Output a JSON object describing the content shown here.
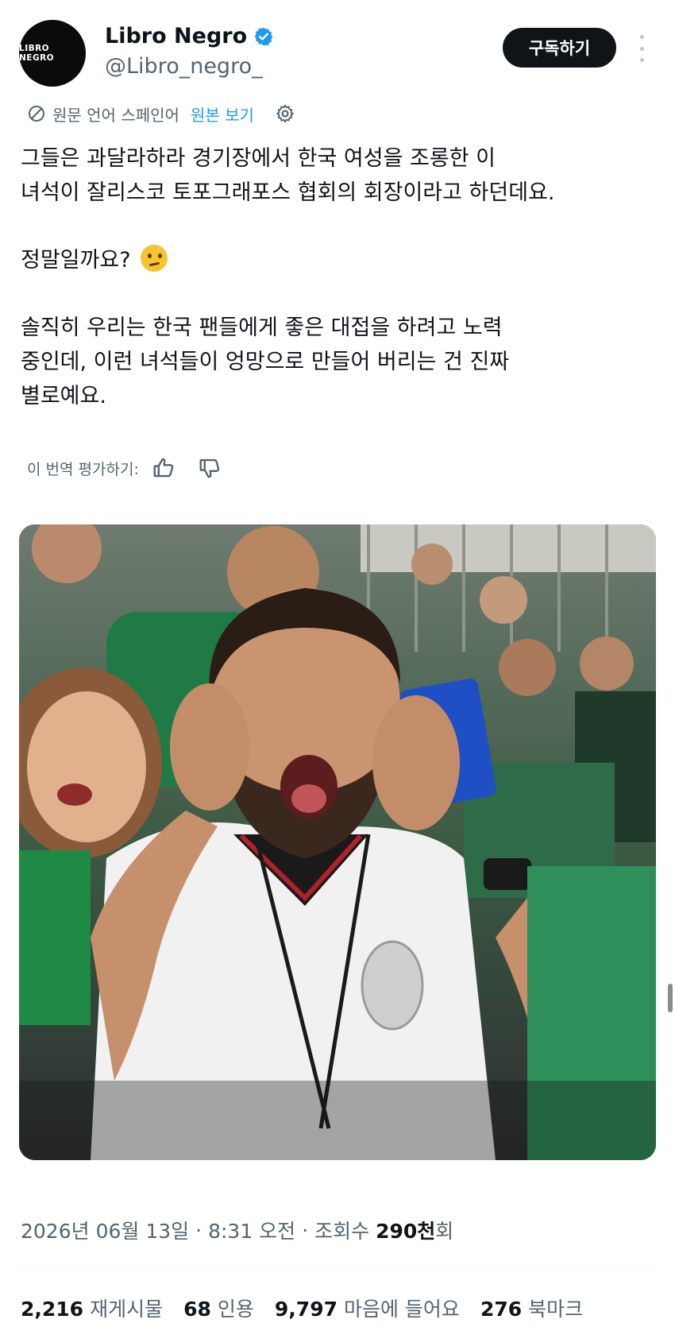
{
  "account": {
    "avatar_text": "LIBRO NEGRO",
    "name": "Libro Negro",
    "handle": "@Libro_negro_",
    "subscribe_label": "구독하기"
  },
  "translation": {
    "source_label": "원문 언어 스페인어",
    "show_original": "원본 보기"
  },
  "tweet": {
    "line1": "그들은 과달라하라 경기장에서 한국 여성을 조롱한 이",
    "line2": "녀석이 잘리스코 토포그래포스 협회의 회장이라고 하던데요.",
    "line3": "정말일까요?",
    "line4": "솔직히 우리는 한국 팬들에게 좋은 대접을 하려고 노력",
    "line5": "중인데, 이런 녀석들이 엉망으로 만들어 버리는 건 진짜",
    "line6": "별로예요."
  },
  "rate": {
    "label": "이 번역 평가하기:"
  },
  "meta": {
    "date": "2026년 06월 13일",
    "time": "8:31 오전",
    "views_label": "조회수",
    "views_count": "290천",
    "views_suffix": "회"
  },
  "stats": {
    "retweets": "2,216",
    "retweets_label": "재게시물",
    "quotes": "68",
    "quotes_label": "인용",
    "likes": "9,797",
    "likes_label": "마음에 들어요",
    "bookmarks": "276",
    "bookmarks_label": "북마크"
  },
  "colors": {
    "accent": "#1d9bf0",
    "text": "#0f1419",
    "muted": "#536471"
  },
  "icons": [
    "verified-badge-icon",
    "more-icon",
    "globe-translate-icon",
    "gear-icon",
    "thumbs-up-icon",
    "thumbs-down-icon"
  ]
}
